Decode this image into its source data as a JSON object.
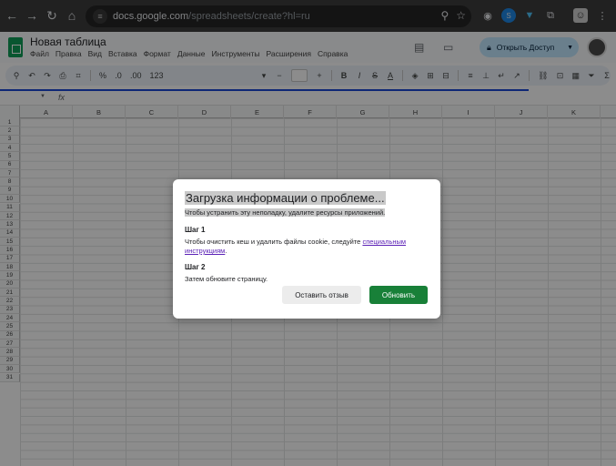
{
  "browser": {
    "url_host": "docs.google.com",
    "url_path": "/spreadsheets/create?hl=ru",
    "icons": [
      "back-icon",
      "forward-icon",
      "reload-icon",
      "home-icon",
      "site-info-icon",
      "zoom-icon",
      "bookmark-star-icon",
      "extension-globe-icon",
      "extension-s-icon",
      "extension-bird-icon",
      "extensions-puzzle-icon",
      "profile-icon",
      "menu-dots-icon"
    ]
  },
  "docs": {
    "title": "Новая таблица",
    "menu": [
      "Файл",
      "Правка",
      "Вид",
      "Вставка",
      "Формат",
      "Данные",
      "Инструменты",
      "Расширения",
      "Справка"
    ],
    "share_label": "Открыть Доступ",
    "toolbar": {
      "format_symbols": [
        "%",
        ".0",
        ".00",
        "123"
      ]
    }
  },
  "grid": {
    "columns": [
      "A",
      "B",
      "C",
      "D",
      "E",
      "F",
      "G",
      "H",
      "I",
      "J",
      "K"
    ],
    "rows": [
      "1",
      "2",
      "3",
      "4",
      "5",
      "6",
      "7",
      "8",
      "9",
      "10",
      "11",
      "12",
      "13",
      "14",
      "15",
      "16",
      "17",
      "18",
      "19",
      "20",
      "21",
      "22",
      "23",
      "24",
      "25",
      "26",
      "27",
      "28",
      "29",
      "30",
      "31"
    ],
    "fx_label": "fx"
  },
  "dialog": {
    "title": "Загрузка информации о проблеме...",
    "subtitle": "Чтобы устранить эту неполадку, удалите ресурсы приложений.",
    "step1_title": "Шаг 1",
    "step1_text": "Чтобы очистить кеш и удалить файлы cookie, следуйте ",
    "step1_link": "специальным инструкциям",
    "step1_end": ".",
    "step2_title": "Шаг 2",
    "step2_text": "Затем обновите страницу.",
    "feedback_button": "Оставить отзыв",
    "refresh_button": "Обновить"
  },
  "colors": {
    "refresh_button": "#188038",
    "share_button": "#c2e7ff",
    "sheets_green": "#0f9d58"
  }
}
